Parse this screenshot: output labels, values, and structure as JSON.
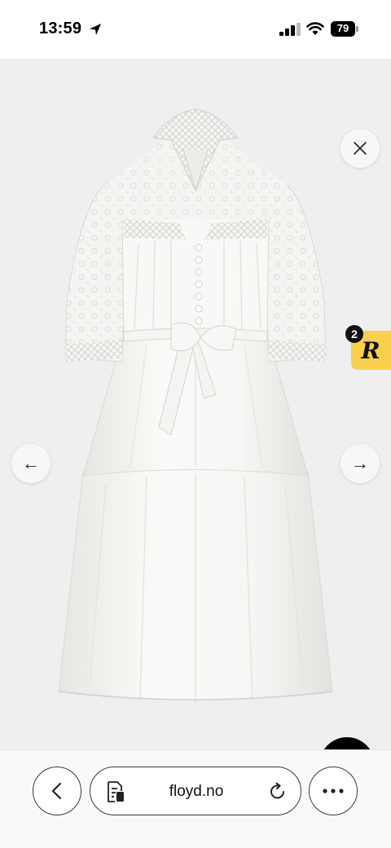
{
  "status_bar": {
    "time": "13:59",
    "battery": "79"
  },
  "gallery": {
    "image_name": "white-broderie-anglaise-tiered-midi-dress",
    "prev_arrow": "←",
    "next_arrow": "→",
    "close_icon": "close-icon"
  },
  "reward_badge": {
    "letter": "R",
    "count": "2",
    "color": "#f9cf4e"
  },
  "chat": {
    "icon": "chat-bubble-icon",
    "color": "#000000"
  },
  "browser": {
    "url": "floyd.no",
    "back_icon": "chevron-left-icon",
    "page_icon": "page-settings-icon",
    "reload_icon": "reload-icon",
    "more_icon": "more-dots-icon"
  }
}
